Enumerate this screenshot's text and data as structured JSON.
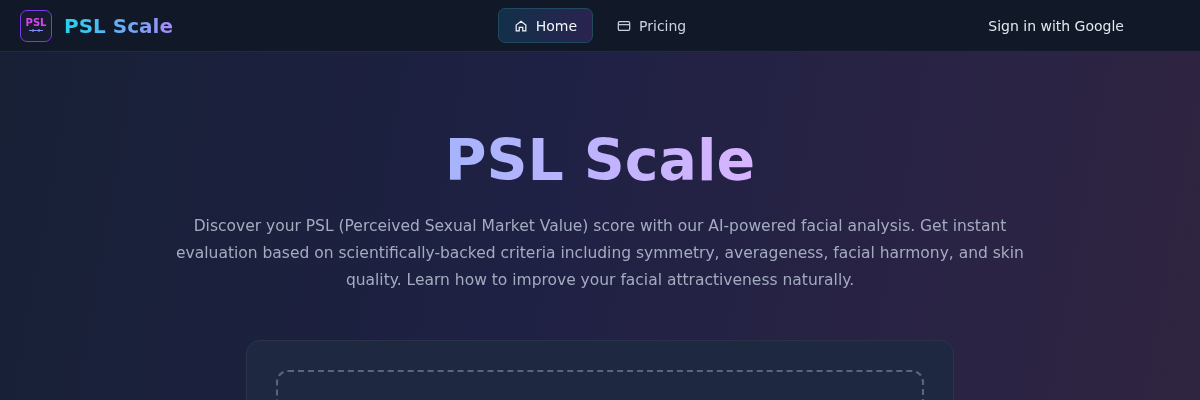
{
  "header": {
    "logo": {
      "badge_text": "PSL",
      "name": "PSL Scale"
    },
    "nav": [
      {
        "label": "Home",
        "kind": "home",
        "selected": true
      },
      {
        "label": "Pricing",
        "kind": "card",
        "selected": false
      }
    ],
    "sign_in": "Sign in with Google"
  },
  "hero": {
    "title": "PSL Scale",
    "description": "Discover your PSL (Perceived Sexual Market Value) score with our AI-powered facial analysis. Get instant evaluation based on scientifically-backed criteria including symmetry, averageness, facial harmony, and skin quality. Learn how to improve your facial attractiveness naturally."
  },
  "upload": {
    "kind": "dropzone"
  }
}
